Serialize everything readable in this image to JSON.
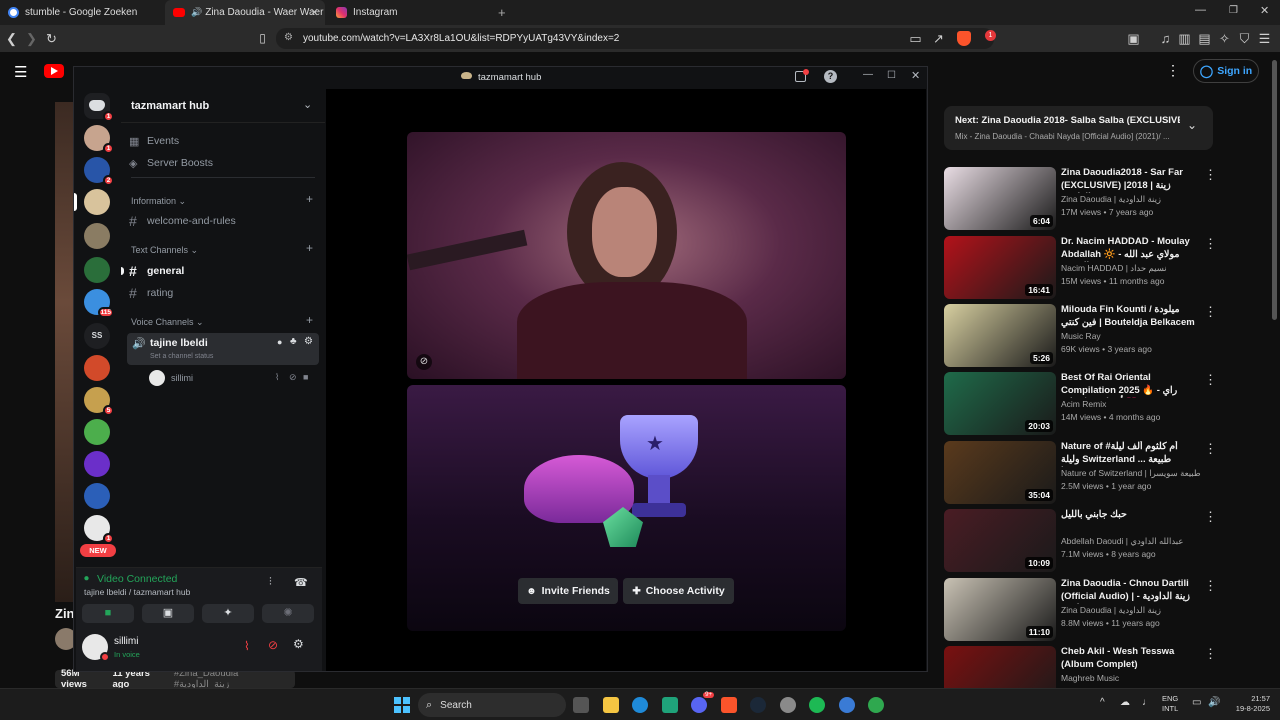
{
  "browser": {
    "tabs": [
      {
        "title": "stumble - Google Zoeken"
      },
      {
        "title": "Zina Daoudia - Waer Waer (C"
      },
      {
        "title": "Instagram"
      }
    ],
    "url": "youtube.com/watch?v=LA3Xr8La1OU&list=RDPYyUATg43VY&index=2",
    "extension_badge": "1"
  },
  "youtube": {
    "sign_in": "Sign in",
    "logo_text": "Y",
    "video_title_partial": "Zin",
    "views_line": "56M views",
    "age_line": "11 years ago",
    "hashtags": "#Zina_Daoudia #زينة_الداودية",
    "next_up": {
      "label": "Next: Zina Daoudia 2018- Salba Salba (EXCLUSIVE)...",
      "sub": "Mix - Zina Daoudia - Chaabi Nayda [Official Audio] (2021)/ ..."
    },
    "recommendations": [
      {
        "title": "Zina Daoudia2018 - Sar Far (EXCLUSIVE) |2018 | زينة الداودية",
        "channel": "Zina Daoudia | زينة الداودية",
        "meta": "17M views • 7 years ago",
        "duration": "6:04",
        "color": "#e9dde4"
      },
      {
        "title": "Dr. Nacim HADDAD - Moulay Abdallah 🔆 مولاي عبد الله - الشيخة ...",
        "channel": "Nacim HADDAD | نسيم حداد",
        "meta": "15M views • 11 months ago",
        "duration": "16:41",
        "color": "#b3121a"
      },
      {
        "title": "Milouda Fin Kounti / ميلودة فين كنتي | Bouteldja Belkacem ...",
        "channel": "Music Ray",
        "meta": "69K views • 3 years ago",
        "duration": "5:26",
        "color": "#d7cfa0"
      },
      {
        "title": "Best Of Rai Oriental Compilation 2025 🔥 راي - أجمل ريمكسات 💗 ...",
        "channel": "Acim Remix",
        "meta": "14M views • 4 months ago",
        "duration": "20:03",
        "color": "#1f6b4a"
      },
      {
        "title": "Nature of #أم كلثوم ألف ليلة وليلة Switzerland ... طبيعة سويسرا#",
        "channel": "Nature of Switzerland | طبيعة سويسرا",
        "meta": "2.5M views • 1 year ago",
        "duration": "35:04",
        "color": "#5a3a1c"
      },
      {
        "title": "حبك جابني بالليل",
        "channel": "Abdellah Daoudi | عبدالله الداودي",
        "meta": "7.1M views • 8 years ago",
        "duration": "10:09",
        "color": "#4a1c24"
      },
      {
        "title": "Zina Daoudia - Chnou Dartili (Official Audio) | زينة الداودية - اشنو",
        "channel": "Zina Daoudia | زينة الداودية",
        "meta": "8.8M views • 11 years ago",
        "duration": "11:10",
        "color": "#c9c2b4"
      },
      {
        "title": "Cheb Akil - Wesh Tesswa (Album Complet)",
        "channel": "Maghreb Music",
        "meta": "",
        "duration": "",
        "color": "#7a1010"
      }
    ]
  },
  "discord": {
    "window_title": "tazmamart hub",
    "server_name": "tazmamart hub",
    "menu": {
      "events": "Events",
      "boosts": "Server Boosts"
    },
    "categories": {
      "information": "Information",
      "text": "Text Channels",
      "voice": "Voice Channels"
    },
    "channels": {
      "welcome": "welcome-and-rules",
      "general": "general",
      "rating": "rating"
    },
    "voice_channel": {
      "name": "tajine lbeldi",
      "status": "Set a channel status",
      "member": "sillimi"
    },
    "guild_badges": [
      "1",
      "1",
      "2",
      "115",
      "5",
      "1"
    ],
    "guild_ss": "SS",
    "new_label": "NEW",
    "connection": {
      "status": "Video Connected",
      "location": "tajine lbeldi / tazmamart hub"
    },
    "user": {
      "name": "sillimi",
      "status": "In voice"
    },
    "activity": {
      "invite": "Invite Friends",
      "choose": "Choose Activity"
    }
  },
  "taskbar": {
    "search": "Search",
    "lang_top": "ENG",
    "lang_bottom": "INTL",
    "time": "21:57",
    "date": "19-8-2025",
    "discord_badge": "9+"
  },
  "colors": {
    "accent_green": "#23a55a",
    "discord_red": "#f23f43",
    "yt_red": "#ff0000"
  }
}
